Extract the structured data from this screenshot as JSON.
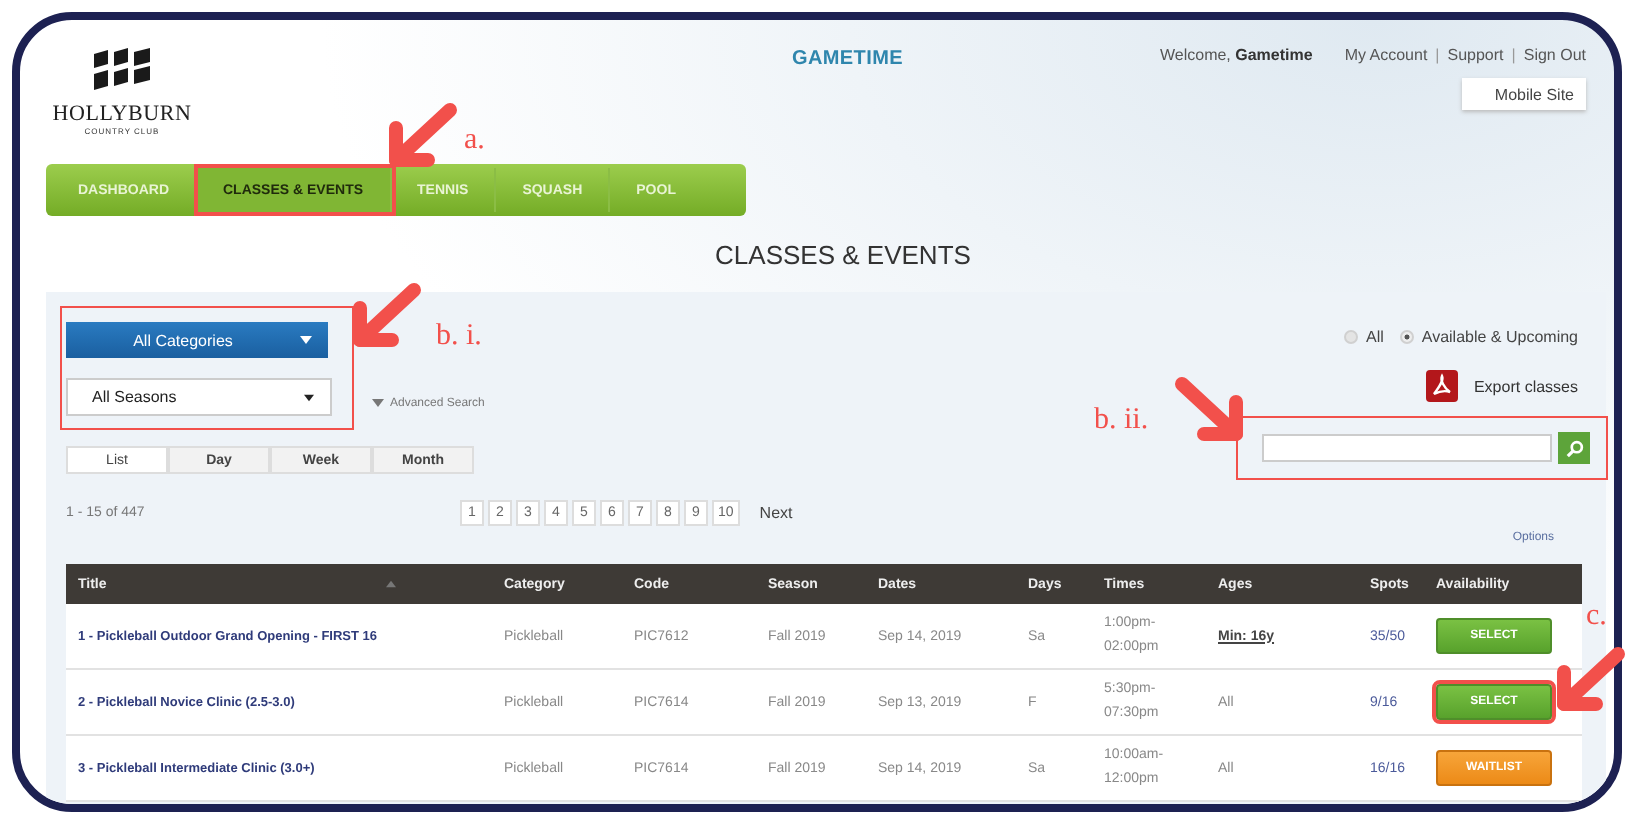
{
  "header": {
    "logo": {
      "name": "HOLLYBURN",
      "tagline": "COUNTRY CLUB"
    },
    "app_name": "GAMETIME",
    "welcome": {
      "prefix": "Welcome,",
      "user": "Gametime"
    },
    "links": [
      "My Account",
      "Support",
      "Sign Out"
    ],
    "link_separator": "|",
    "mobile_button": "Mobile Site"
  },
  "nav": [
    {
      "label": "DASHBOARD",
      "selected": false,
      "highlighted": false
    },
    {
      "label": "CLASSES & EVENTS",
      "selected": true,
      "highlighted": true
    },
    {
      "label": "TENNIS",
      "selected": false,
      "highlighted": false
    },
    {
      "label": "SQUASH",
      "selected": false,
      "highlighted": false
    },
    {
      "label": "POOL",
      "selected": false,
      "highlighted": false
    }
  ],
  "page_title": "CLASSES & EVENTS",
  "filters": {
    "highlighted": true,
    "category": "All Categories",
    "season": "All Seasons",
    "advanced_search": "Advanced Search"
  },
  "view_tabs": [
    {
      "label": "List",
      "selected": true
    },
    {
      "label": "Day",
      "selected": false
    },
    {
      "label": "Week",
      "selected": false
    },
    {
      "label": "Month",
      "selected": false
    }
  ],
  "availability_filter": [
    {
      "label": "All",
      "selected": false
    },
    {
      "label": "Available & Upcoming",
      "selected": true
    }
  ],
  "export": "Export classes",
  "search": {
    "highlighted": true
  },
  "result_count": "1 - 15 of 447",
  "pagination": {
    "pages": [
      "1",
      "2",
      "3",
      "4",
      "5",
      "6",
      "7",
      "8",
      "9",
      "10"
    ],
    "next": "Next"
  },
  "options_link": "Options",
  "table": {
    "columns": [
      "Title",
      "Category",
      "Code",
      "Season",
      "Dates",
      "Days",
      "Times",
      "Ages",
      "Spots",
      "Availability"
    ],
    "rows": [
      {
        "title": "1 - Pickleball Outdoor Grand Opening - FIRST 16",
        "category": "Pickleball",
        "code": "PIC7612",
        "season": "Fall 2019",
        "dates": "Sep 14, 2019",
        "days": "Sa",
        "times": "1:00pm-02:00pm",
        "ages": "Min: 16y",
        "ages_underlined": true,
        "spots": "35/50",
        "action": {
          "label": "SELECT",
          "kind": "select"
        },
        "highlighted": false
      },
      {
        "title": "2 - Pickleball Novice Clinic (2.5-3.0)",
        "category": "Pickleball",
        "code": "PIC7614",
        "season": "Fall 2019",
        "dates": "Sep 13, 2019",
        "days": "F",
        "times": "5:30pm-07:30pm",
        "ages": "All",
        "ages_underlined": false,
        "spots": "9/16",
        "action": {
          "label": "SELECT",
          "kind": "select"
        },
        "highlighted": true
      },
      {
        "title": "3 - Pickleball Intermediate Clinic (3.0+)",
        "category": "Pickleball",
        "code": "PIC7614",
        "season": "Fall 2019",
        "dates": "Sep 14, 2019",
        "days": "Sa",
        "times": "10:00am-12:00pm",
        "ages": "All",
        "ages_underlined": false,
        "spots": "16/16",
        "action": {
          "label": "WAITLIST",
          "kind": "waitlist"
        },
        "highlighted": false
      }
    ]
  },
  "annotations": [
    {
      "label": "a."
    },
    {
      "label": "b. i."
    },
    {
      "label": "b. ii."
    },
    {
      "label": "c."
    }
  ]
}
